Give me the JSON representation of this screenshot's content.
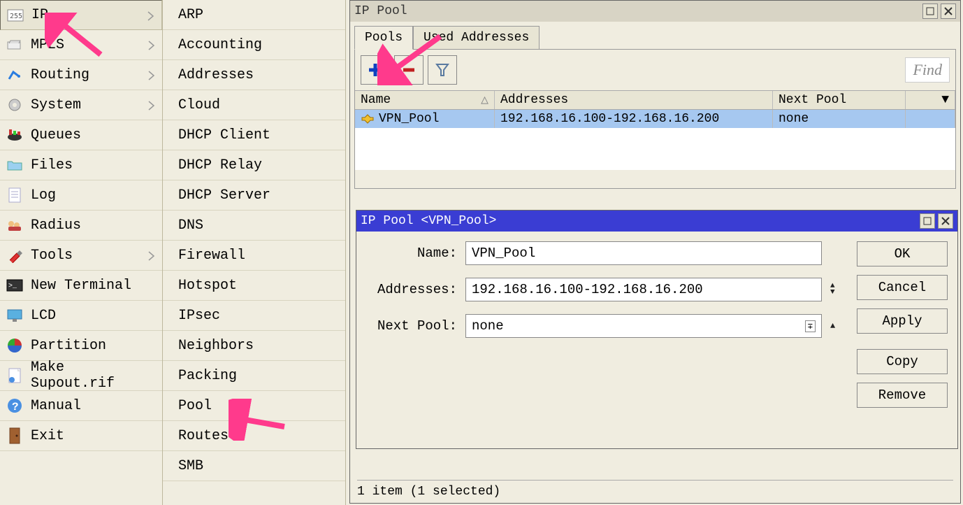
{
  "main_menu": {
    "items": [
      {
        "label": "IP",
        "has_submenu": true,
        "selected": true
      },
      {
        "label": "MPLS",
        "has_submenu": true
      },
      {
        "label": "Routing",
        "has_submenu": true
      },
      {
        "label": "System",
        "has_submenu": true
      },
      {
        "label": "Queues"
      },
      {
        "label": "Files"
      },
      {
        "label": "Log"
      },
      {
        "label": "Radius"
      },
      {
        "label": "Tools",
        "has_submenu": true
      },
      {
        "label": "New Terminal"
      },
      {
        "label": "LCD"
      },
      {
        "label": "Partition"
      },
      {
        "label": "Make Supout.rif"
      },
      {
        "label": "Manual"
      },
      {
        "label": "Exit"
      }
    ]
  },
  "submenu": {
    "items": [
      "ARP",
      "Accounting",
      "Addresses",
      "Cloud",
      "DHCP Client",
      "DHCP Relay",
      "DHCP Server",
      "DNS",
      "Firewall",
      "Hotspot",
      "IPsec",
      "Neighbors",
      "Packing",
      "Pool",
      "Routes",
      "SMB"
    ]
  },
  "ippool_window": {
    "title": "IP Pool",
    "tabs": [
      {
        "label": "Pools",
        "active": true
      },
      {
        "label": "Used Addresses",
        "active": false
      }
    ],
    "find_placeholder": "Find",
    "columns": {
      "name": "Name",
      "addresses": "Addresses",
      "next_pool": "Next Pool"
    },
    "rows": [
      {
        "name": "VPN_Pool",
        "addresses": "192.168.16.100-192.168.16.200",
        "next_pool": "none",
        "selected": true
      }
    ],
    "status": "1 item (1 selected)"
  },
  "edit_window": {
    "title": "IP Pool <VPN_Pool>",
    "fields": {
      "name_label": "Name:",
      "name_value": "VPN_Pool",
      "addresses_label": "Addresses:",
      "addresses_value": "192.168.16.100-192.168.16.200",
      "next_pool_label": "Next Pool:",
      "next_pool_value": "none"
    },
    "buttons": {
      "ok": "OK",
      "cancel": "Cancel",
      "apply": "Apply",
      "copy": "Copy",
      "remove": "Remove"
    }
  }
}
